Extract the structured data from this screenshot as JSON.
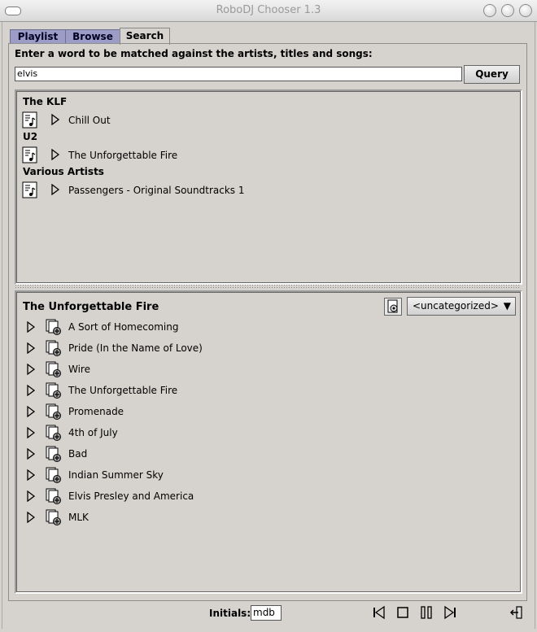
{
  "window": {
    "title": "RoboDJ Chooser 1.3"
  },
  "tabs": [
    {
      "label": "Playlist"
    },
    {
      "label": "Browse"
    },
    {
      "label": "Search"
    }
  ],
  "search": {
    "prompt": "Enter a word to be matched against the artists, titles and songs:",
    "value": "elvis",
    "query_label": "Query"
  },
  "results": [
    {
      "artist": "The KLF",
      "album": "Chill Out"
    },
    {
      "artist": "U2",
      "album": "The Unforgettable Fire"
    },
    {
      "artist": "Various Artists",
      "album": "Passengers - Original Soundtracks 1"
    }
  ],
  "detail": {
    "title": "The Unforgettable Fire",
    "category": "<uncategorized>",
    "tracks": [
      "A Sort of Homecoming",
      "Pride (In the Name of Love)",
      "Wire",
      "The Unforgettable Fire",
      "Promenade",
      "4th of July",
      "Bad",
      "Indian Summer Sky",
      "Elvis Presley and America",
      "MLK"
    ]
  },
  "footer": {
    "initials_label": "Initials:",
    "initials_value": "mdb"
  }
}
